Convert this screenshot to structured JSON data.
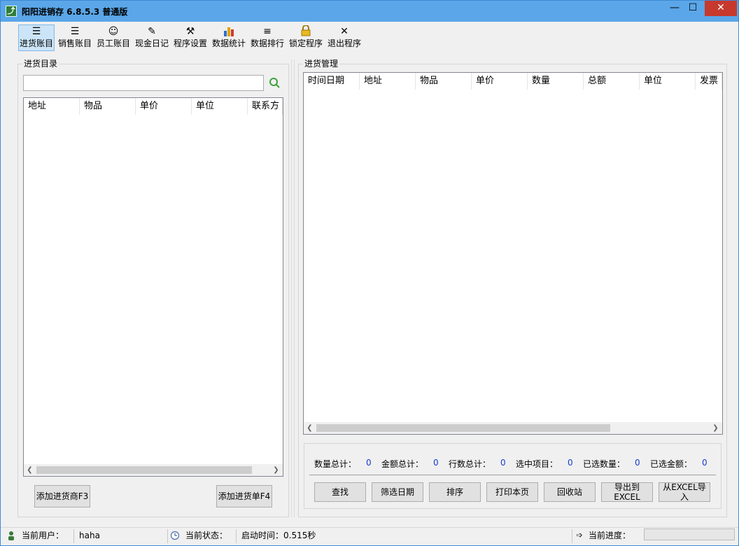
{
  "window": {
    "title": "阳阳进销存 6.8.5.3 普通版",
    "min_glyph": "—",
    "max_glyph": "☐",
    "close_glyph": "✕"
  },
  "toolbar": {
    "items": [
      {
        "label": "进货账目",
        "icon": "list-icon",
        "glyph": "☰"
      },
      {
        "label": "销售账目",
        "icon": "list-icon",
        "glyph": "☰"
      },
      {
        "label": "员工账目",
        "icon": "people-icon",
        "glyph": "☺"
      },
      {
        "label": "现金日记",
        "icon": "note-edit-icon",
        "glyph": "✎"
      },
      {
        "label": "程序设置",
        "icon": "tools-icon",
        "glyph": "⚒"
      },
      {
        "label": "数据统计",
        "icon": "bar-chart-icon",
        "glyph": "▮"
      },
      {
        "label": "数据排行",
        "icon": "ranked-list-icon",
        "glyph": "≡"
      },
      {
        "label": "锁定程序",
        "icon": "lock-icon",
        "glyph": "🔒"
      },
      {
        "label": "退出程序",
        "icon": "close-icon",
        "glyph": "✕"
      }
    ]
  },
  "left_panel": {
    "title": "进货目录",
    "search_value": "",
    "columns": [
      "地址",
      "物品",
      "单价",
      "单位",
      "联系方"
    ],
    "add_supplier_button": "添加进货商F3",
    "add_order_button": "添加进货单F4"
  },
  "right_panel": {
    "title": "进货管理",
    "columns": [
      "时间日期",
      "地址",
      "物品",
      "单价",
      "数量",
      "总额",
      "单位",
      "发票"
    ]
  },
  "stats": {
    "qty_total_label": "数量总计：",
    "qty_total_value": "0",
    "amount_total_label": "金额总计：",
    "amount_total_value": "0",
    "row_total_label": "行数总计：",
    "row_total_value": "0",
    "selected_items_label": "选中项目：",
    "selected_items_value": "0",
    "selected_qty_label": "已选数量：",
    "selected_qty_value": "0",
    "selected_amount_label": "已选金额：",
    "selected_amount_value": "0"
  },
  "actions": {
    "find": "查找",
    "filter_date": "筛选日期",
    "sort": "排序",
    "print_page": "打印本页",
    "recycle_bin": "回收站",
    "export_excel": "导出到EXCEL",
    "import_excel": "从EXCEL导入"
  },
  "statusbar": {
    "user_label": "当前用户：",
    "user_value": "haha",
    "status_label": "当前状态：",
    "status_value": "启动时间：0.515秒",
    "progress_label": "当前进度：",
    "progress_fraction": 0
  },
  "colors": {
    "titlebar": "#5aa6e8",
    "close_button": "#c7392d",
    "stat_value": "#1a3ccc",
    "toolbar_active": "#cce4f7"
  }
}
